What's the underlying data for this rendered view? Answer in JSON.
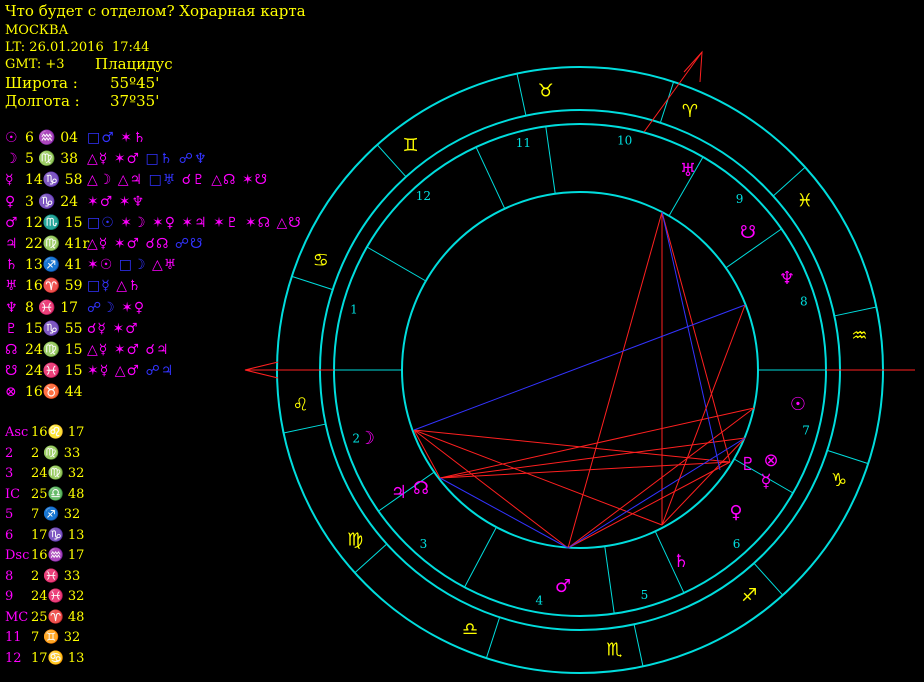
{
  "header": {
    "title": "Что будет с отделом? Хорарная карта",
    "city": "МОСКВА",
    "lt": "LT: 26.01.2016  17:44",
    "gmt": "GMT: +3",
    "system": "Плацидус",
    "lat_label": "Широта :",
    "lat_value": "55º45'",
    "lon_label": "Долгота :",
    "lon_value": "37º35'"
  },
  "planets": [
    {
      "glyph": "☉",
      "pos": "6 ♒ 04",
      "aspects": [
        {
          "t": "□♂",
          "c": "b"
        },
        {
          "t": "✶♄",
          "c": "r"
        }
      ]
    },
    {
      "glyph": "☽",
      "pos": "5 ♍ 38",
      "aspects": [
        {
          "t": "△☿",
          "c": "r"
        },
        {
          "t": "✶♂",
          "c": "r"
        },
        {
          "t": "□♄",
          "c": "b"
        },
        {
          "t": "☍♆",
          "c": "b"
        }
      ]
    },
    {
      "glyph": "☿",
      "pos": "14♑ 58",
      "aspects": [
        {
          "t": "△☽",
          "c": "r"
        },
        {
          "t": "△♃",
          "c": "r"
        },
        {
          "t": "□♅",
          "c": "b"
        },
        {
          "t": "☌♇",
          "c": "r"
        },
        {
          "t": "△☊",
          "c": "r"
        },
        {
          "t": "✶☋",
          "c": "r"
        }
      ]
    },
    {
      "glyph": "♀",
      "pos": "3 ♑ 24",
      "aspects": [
        {
          "t": "✶♂",
          "c": "r"
        },
        {
          "t": "✶♆",
          "c": "r"
        }
      ]
    },
    {
      "glyph": "♂",
      "pos": "12♏ 15",
      "aspects": [
        {
          "t": "□☉",
          "c": "b"
        },
        {
          "t": "✶☽",
          "c": "r"
        },
        {
          "t": "✶♀",
          "c": "r"
        },
        {
          "t": "✶♃",
          "c": "r"
        },
        {
          "t": "✶♇",
          "c": "r"
        },
        {
          "t": "✶☊",
          "c": "r"
        },
        {
          "t": "△☋",
          "c": "r"
        }
      ]
    },
    {
      "glyph": "♃",
      "pos": "22♍ 41r",
      "aspects": [
        {
          "t": "△☿",
          "c": "r"
        },
        {
          "t": "✶♂",
          "c": "r"
        },
        {
          "t": "☌☊",
          "c": "r"
        },
        {
          "t": "☍☋",
          "c": "b"
        }
      ]
    },
    {
      "glyph": "♄",
      "pos": "13♐ 41",
      "aspects": [
        {
          "t": "✶☉",
          "c": "r"
        },
        {
          "t": "□☽",
          "c": "b"
        },
        {
          "t": "△♅",
          "c": "r"
        }
      ]
    },
    {
      "glyph": "♅",
      "pos": "16♈ 59",
      "aspects": [
        {
          "t": "□☿",
          "c": "b"
        },
        {
          "t": "△♄",
          "c": "r"
        }
      ]
    },
    {
      "glyph": "♆",
      "pos": "8 ♓ 17",
      "aspects": [
        {
          "t": "☍☽",
          "c": "b"
        },
        {
          "t": "✶♀",
          "c": "r"
        }
      ]
    },
    {
      "glyph": "♇",
      "pos": "15♑ 55",
      "aspects": [
        {
          "t": "☌☿",
          "c": "r"
        },
        {
          "t": "✶♂",
          "c": "r"
        }
      ]
    },
    {
      "glyph": "☊",
      "pos": "24♍ 15",
      "aspects": [
        {
          "t": "△☿",
          "c": "r"
        },
        {
          "t": "✶♂",
          "c": "r"
        },
        {
          "t": "☌♃",
          "c": "r"
        }
      ]
    },
    {
      "glyph": "☋",
      "pos": "24♓ 15",
      "aspects": [
        {
          "t": "✶☿",
          "c": "r"
        },
        {
          "t": "△♂",
          "c": "r"
        },
        {
          "t": "☍♃",
          "c": "b"
        }
      ]
    },
    {
      "glyph": "⊗",
      "pos": "16♉ 44",
      "aspects": []
    }
  ],
  "cusps": [
    {
      "n": "Asc",
      "v": "16♌ 17"
    },
    {
      "n": "2",
      "v": "2 ♍ 33"
    },
    {
      "n": "3",
      "v": "24♍ 32"
    },
    {
      "n": "IC",
      "v": "25♎ 48"
    },
    {
      "n": "5",
      "v": "7 ♐ 32"
    },
    {
      "n": "6",
      "v": "17♑ 13"
    },
    {
      "n": "Dsc",
      "v": "16♒ 17"
    },
    {
      "n": "8",
      "v": "2 ♓ 33"
    },
    {
      "n": "9",
      "v": "24♓ 32"
    },
    {
      "n": "MC",
      "v": "25♈ 48"
    },
    {
      "n": "11",
      "v": "7 ♊ 32"
    },
    {
      "n": "12",
      "v": "17♋ 13"
    }
  ],
  "wheel": {
    "zodiac_glyphs": [
      "♉",
      "♈",
      "♓",
      "♒",
      "♑",
      "♐",
      "♏",
      "♎",
      "♍",
      "♌",
      "♋",
      "♊"
    ],
    "house_numbers": [
      "10",
      "9",
      "8",
      "7",
      "6",
      "5",
      "4",
      "3",
      "2",
      "1",
      "12",
      "11"
    ],
    "chart_planets": [
      {
        "g": "♅",
        "label": "uranus"
      },
      {
        "g": "☋",
        "label": "south-node"
      },
      {
        "g": "♆",
        "label": "neptune"
      },
      {
        "g": "☉",
        "label": "sun"
      },
      {
        "g": "♇",
        "label": "pluto"
      },
      {
        "g": "⊗",
        "label": "fortune"
      },
      {
        "g": "☿",
        "label": "mercury"
      },
      {
        "g": "♀",
        "label": "venus"
      },
      {
        "g": "♄",
        "label": "saturn"
      },
      {
        "g": "♂",
        "label": "mars"
      },
      {
        "g": "♃",
        "label": "jupiter"
      },
      {
        "g": "☊",
        "label": "north-node"
      },
      {
        "g": "☽",
        "label": "moon"
      }
    ],
    "colors": {
      "ring": "#00dddd",
      "sign": "#ffff00",
      "planet": "#ff00ff",
      "axis": "#ff2020",
      "hard": "#ff2020",
      "soft": "#3333ff"
    }
  }
}
